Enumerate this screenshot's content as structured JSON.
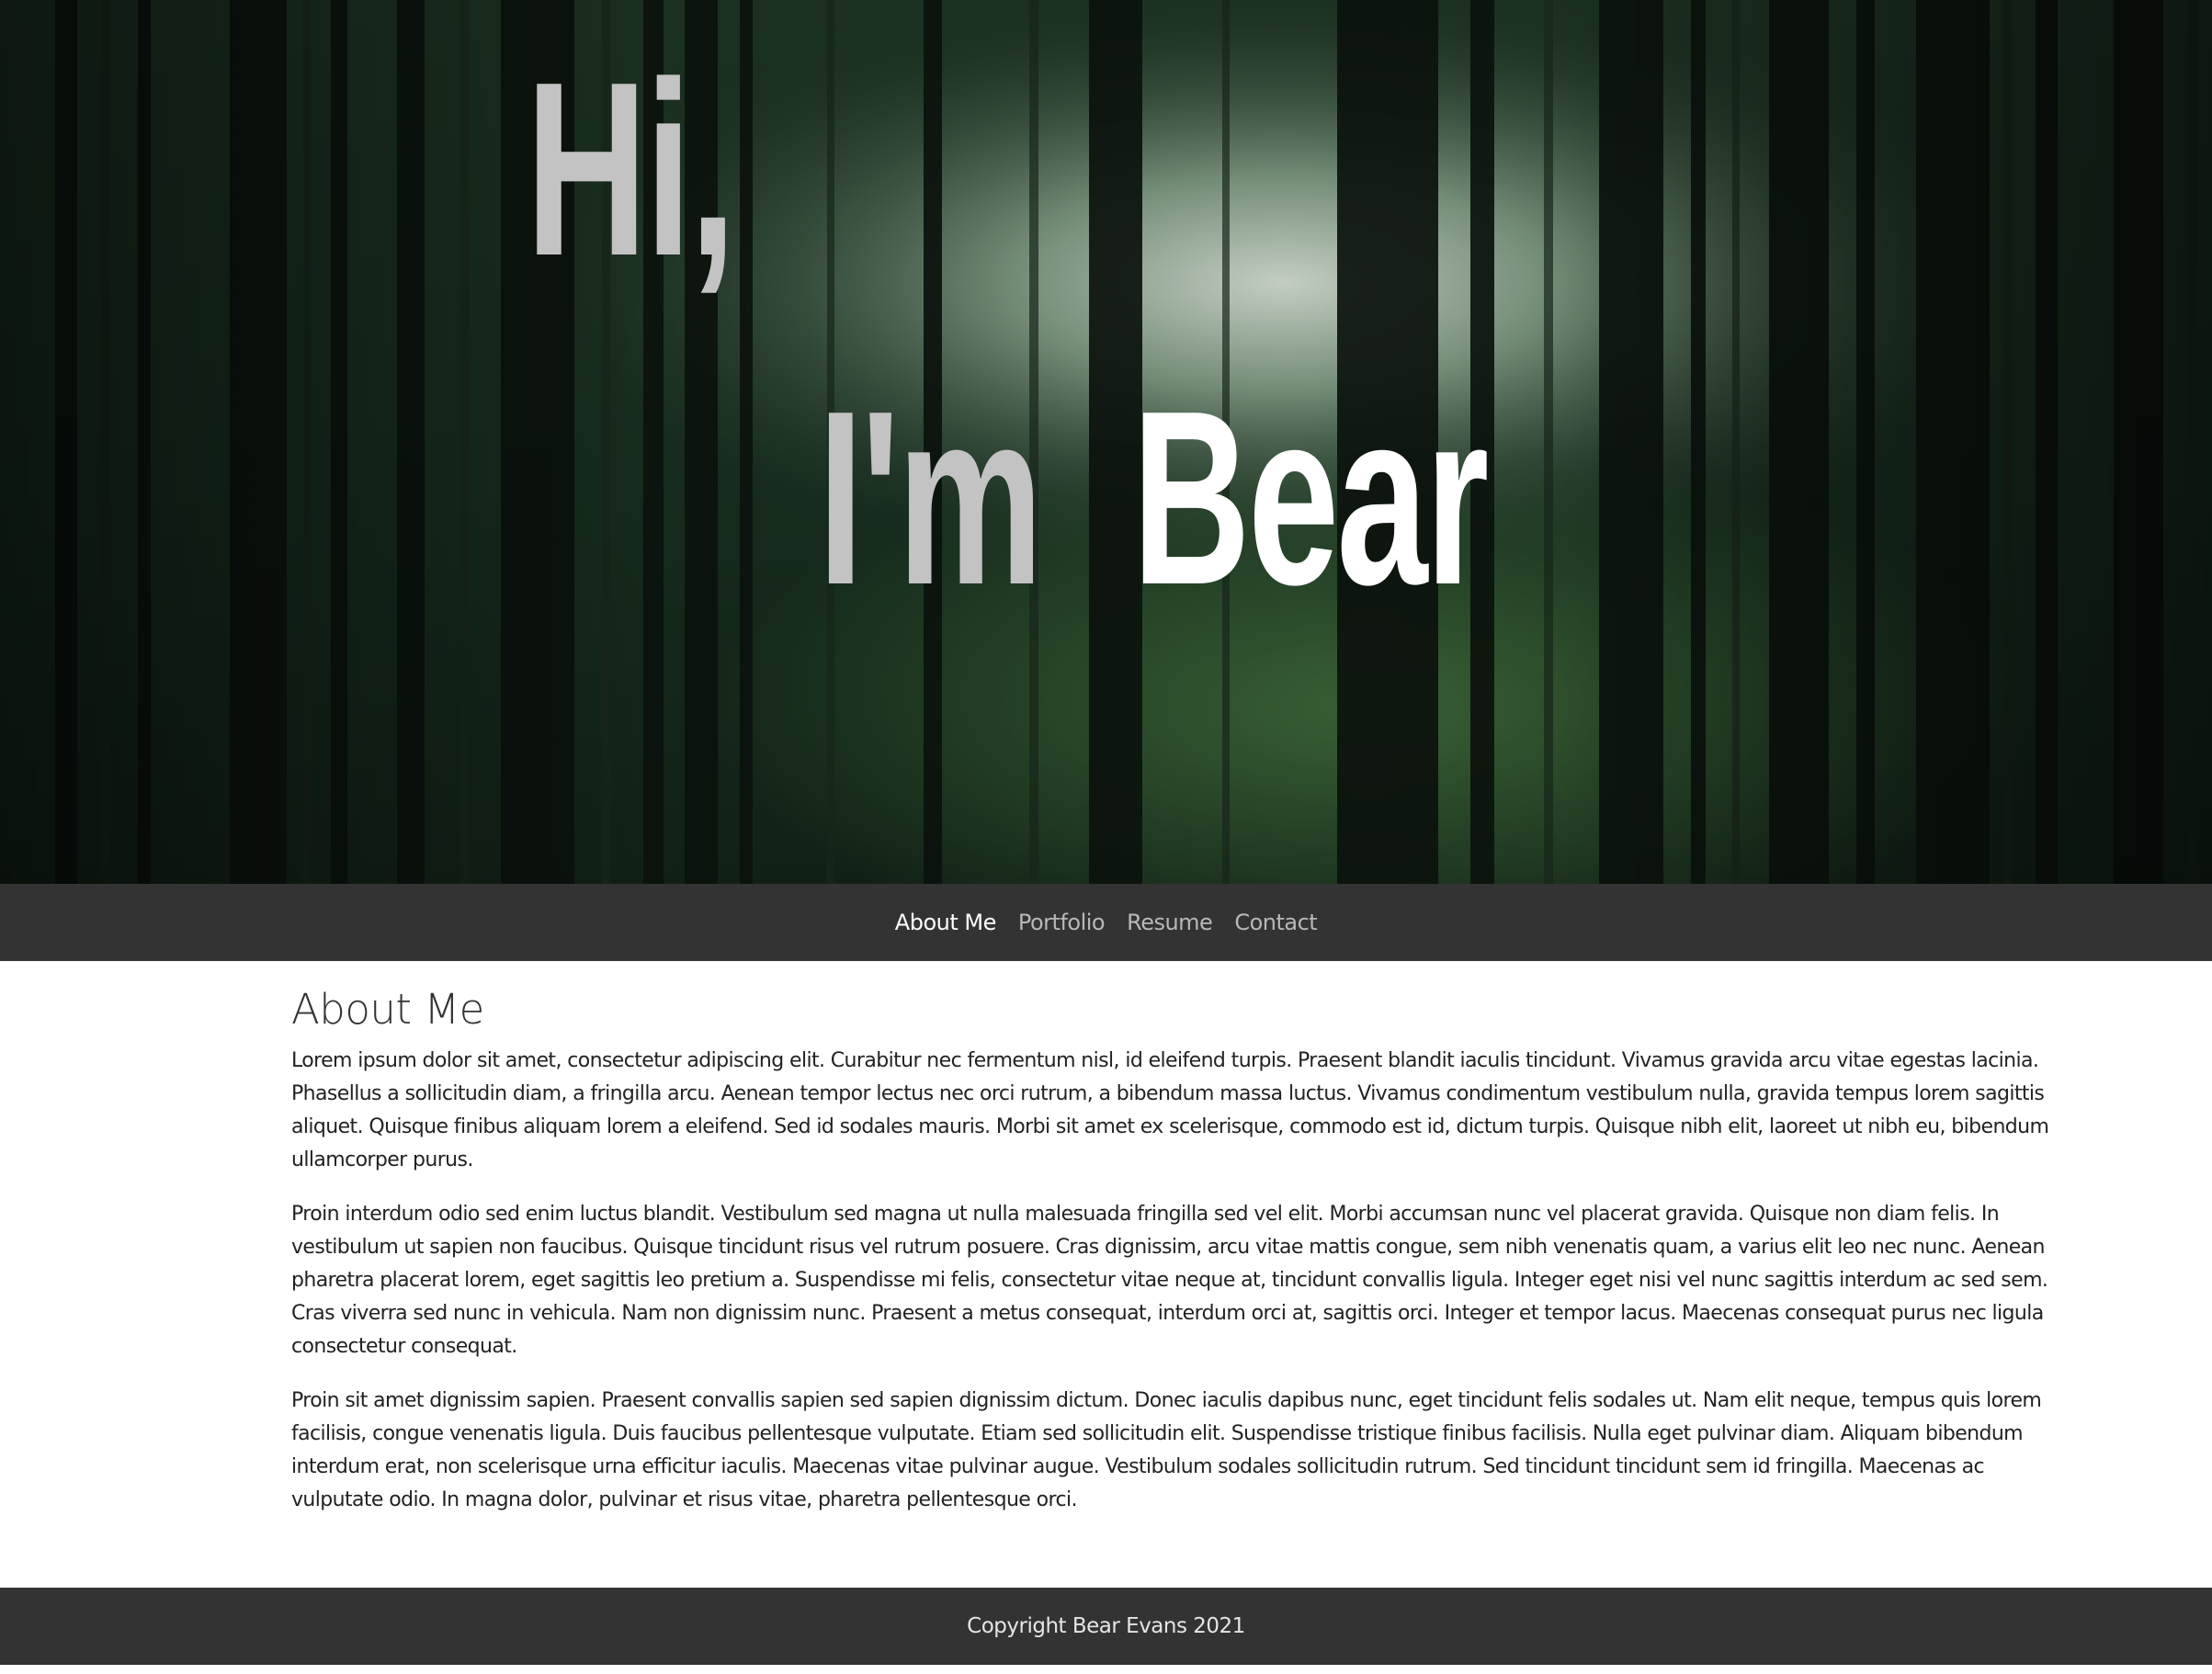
{
  "hero": {
    "greeting": "Hi,",
    "intro": "I'm",
    "name": "Bear"
  },
  "nav": {
    "items": [
      {
        "label": "About Me",
        "active": true
      },
      {
        "label": "Portfolio",
        "active": false
      },
      {
        "label": "Resume",
        "active": false
      },
      {
        "label": "Contact",
        "active": false
      }
    ]
  },
  "about": {
    "title": "About Me",
    "paragraphs": [
      "Lorem ipsum dolor sit amet, consectetur adipiscing elit. Curabitur nec fermentum nisl, id eleifend turpis. Praesent blandit iaculis tincidunt. Vivamus gravida arcu vitae egestas lacinia. Phasellus a sollicitudin diam, a fringilla arcu. Aenean tempor lectus nec orci rutrum, a bibendum massa luctus. Vivamus condimentum vestibulum nulla, gravida tempus lorem sagittis aliquet. Quisque finibus aliquam lorem a eleifend. Sed id sodales mauris. Morbi sit amet ex scelerisque, commodo est id, dictum turpis. Quisque nibh elit, laoreet ut nibh eu, bibendum ullamcorper purus.",
      "Proin interdum odio sed enim luctus blandit. Vestibulum sed magna ut nulla malesuada fringilla sed vel elit. Morbi accumsan nunc vel placerat gravida. Quisque non diam felis. In vestibulum ut sapien non faucibus. Quisque tincidunt risus vel rutrum posuere. Cras dignissim, arcu vitae mattis congue, sem nibh venenatis quam, a varius elit leo nec nunc. Aenean pharetra placerat lorem, eget sagittis leo pretium a. Suspendisse mi felis, consectetur vitae neque at, tincidunt convallis ligula. Integer eget nisi vel nunc sagittis interdum ac sed sem. Cras viverra sed nunc in vehicula. Nam non dignissim nunc. Praesent a metus consequat, interdum orci at, sagittis orci. Integer et tempor lacus. Maecenas consequat purus nec ligula consectetur consequat.",
      "Proin sit amet dignissim sapien. Praesent convallis sapien sed sapien dignissim dictum. Donec iaculis dapibus nunc, eget tincidunt felis sodales ut. Nam elit neque, tempus quis lorem facilisis, congue venenatis ligula. Duis faucibus pellentesque vulputate. Etiam sed sollicitudin elit. Suspendisse tristique finibus facilisis. Nulla eget pulvinar diam. Aliquam bibendum interdum erat, non scelerisque urna efficitur iaculis. Maecenas vitae pulvinar augue. Vestibulum sodales sollicitudin rutrum. Sed tincidunt tincidunt sem id fringilla. Maecenas ac vulputate odio. In magna dolor, pulvinar et risus vitae, pharetra pellentesque orci."
    ]
  },
  "footer": {
    "copyright": "Copyright Bear Evans 2021"
  },
  "colors": {
    "nav_background": "#333333",
    "footer_background": "#333333",
    "hero_dim_text": "#c3c3c3",
    "hero_bright_text": "#ffffff",
    "nav_link": "#b8b8b8",
    "nav_link_active": "#ffffff"
  }
}
